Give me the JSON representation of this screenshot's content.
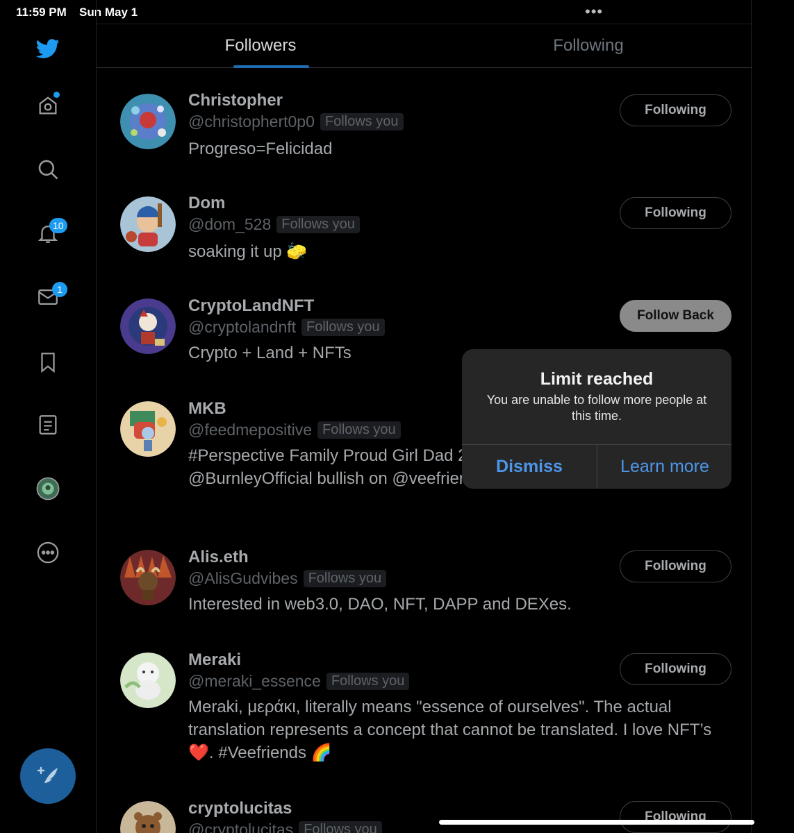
{
  "status_bar": {
    "time": "11:59 PM",
    "date": "Sun May 1",
    "multitask_dots": "•••"
  },
  "sidebar": {
    "items": [
      {
        "name": "twitter-logo",
        "icon": "twitter-bird-icon"
      },
      {
        "name": "home",
        "icon": "home-icon",
        "has_dot": true
      },
      {
        "name": "explore",
        "icon": "search-icon"
      },
      {
        "name": "notifications",
        "icon": "bell-icon",
        "badge": "10"
      },
      {
        "name": "messages",
        "icon": "mail-icon",
        "badge": "1"
      },
      {
        "name": "bookmarks",
        "icon": "bookmark-icon"
      },
      {
        "name": "lists",
        "icon": "list-icon"
      },
      {
        "name": "profile",
        "icon": "avatar-icon"
      },
      {
        "name": "more",
        "icon": "more-circle-icon"
      }
    ],
    "compose_icon": "compose-feather-icon"
  },
  "tabs": [
    {
      "label": "Followers",
      "active": true
    },
    {
      "label": "Following",
      "active": false
    }
  ],
  "follows_you_label": "Follows you",
  "followers": [
    {
      "name": "Christopher",
      "handle": "@christophert0p0",
      "bio": "Progreso=Felicidad",
      "button": "Following"
    },
    {
      "name": "Dom",
      "handle": "@dom_528",
      "bio": "soaking it up 🧽",
      "button": "Following"
    },
    {
      "name": "CryptoLandNFT",
      "handle": "@cryptolandnft",
      "bio": "Crypto + Land + NFTs",
      "button": "Follow Back"
    },
    {
      "name": "MKB",
      "handle": "@feedmepositive",
      "bio": "#Perspective Family Proud Girl Dad 2 Degree Football fan @BurnleyOfficial bullish on @veefriends",
      "button": ""
    },
    {
      "name": "Alis.eth",
      "handle": "@AlisGudvibes",
      "bio": "Interested in web3.0, DAO, NFT, DAPP and DEXes.",
      "button": "Following"
    },
    {
      "name": "Meraki",
      "handle": "@meraki_essence",
      "bio": "Meraki, μεράκι, literally means \"essence of ourselves\". The actual translation represents a concept that cannot be translated. I love NFT’s ❤️. #Veefriends 🌈",
      "button": "Following"
    },
    {
      "name": "cryptolucitas",
      "handle": "@cryptolucitas",
      "bio": "",
      "button": "Following"
    }
  ],
  "alert": {
    "title": "Limit reached",
    "message": "You are unable to follow more people at this time.",
    "dismiss": "Dismiss",
    "learn_more": "Learn more"
  },
  "colors": {
    "accent": "#1d9bf0",
    "alert_button": "#4d96ea",
    "background": "#000000"
  }
}
